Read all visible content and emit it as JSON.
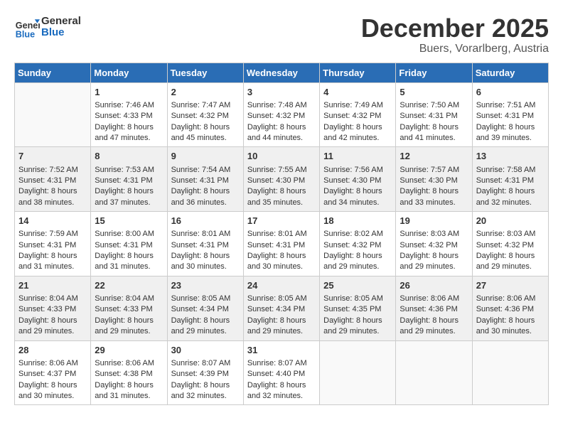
{
  "header": {
    "logo_line1": "General",
    "logo_line2": "Blue",
    "title": "December 2025",
    "subtitle": "Buers, Vorarlberg, Austria"
  },
  "weekdays": [
    "Sunday",
    "Monday",
    "Tuesday",
    "Wednesday",
    "Thursday",
    "Friday",
    "Saturday"
  ],
  "weeks": [
    [
      {
        "day": null,
        "sunrise": null,
        "sunset": null,
        "daylight": null
      },
      {
        "day": "1",
        "sunrise": "Sunrise: 7:46 AM",
        "sunset": "Sunset: 4:33 PM",
        "daylight": "Daylight: 8 hours and 47 minutes."
      },
      {
        "day": "2",
        "sunrise": "Sunrise: 7:47 AM",
        "sunset": "Sunset: 4:32 PM",
        "daylight": "Daylight: 8 hours and 45 minutes."
      },
      {
        "day": "3",
        "sunrise": "Sunrise: 7:48 AM",
        "sunset": "Sunset: 4:32 PM",
        "daylight": "Daylight: 8 hours and 44 minutes."
      },
      {
        "day": "4",
        "sunrise": "Sunrise: 7:49 AM",
        "sunset": "Sunset: 4:32 PM",
        "daylight": "Daylight: 8 hours and 42 minutes."
      },
      {
        "day": "5",
        "sunrise": "Sunrise: 7:50 AM",
        "sunset": "Sunset: 4:31 PM",
        "daylight": "Daylight: 8 hours and 41 minutes."
      },
      {
        "day": "6",
        "sunrise": "Sunrise: 7:51 AM",
        "sunset": "Sunset: 4:31 PM",
        "daylight": "Daylight: 8 hours and 39 minutes."
      }
    ],
    [
      {
        "day": "7",
        "sunrise": "Sunrise: 7:52 AM",
        "sunset": "Sunset: 4:31 PM",
        "daylight": "Daylight: 8 hours and 38 minutes."
      },
      {
        "day": "8",
        "sunrise": "Sunrise: 7:53 AM",
        "sunset": "Sunset: 4:31 PM",
        "daylight": "Daylight: 8 hours and 37 minutes."
      },
      {
        "day": "9",
        "sunrise": "Sunrise: 7:54 AM",
        "sunset": "Sunset: 4:31 PM",
        "daylight": "Daylight: 8 hours and 36 minutes."
      },
      {
        "day": "10",
        "sunrise": "Sunrise: 7:55 AM",
        "sunset": "Sunset: 4:30 PM",
        "daylight": "Daylight: 8 hours and 35 minutes."
      },
      {
        "day": "11",
        "sunrise": "Sunrise: 7:56 AM",
        "sunset": "Sunset: 4:30 PM",
        "daylight": "Daylight: 8 hours and 34 minutes."
      },
      {
        "day": "12",
        "sunrise": "Sunrise: 7:57 AM",
        "sunset": "Sunset: 4:30 PM",
        "daylight": "Daylight: 8 hours and 33 minutes."
      },
      {
        "day": "13",
        "sunrise": "Sunrise: 7:58 AM",
        "sunset": "Sunset: 4:31 PM",
        "daylight": "Daylight: 8 hours and 32 minutes."
      }
    ],
    [
      {
        "day": "14",
        "sunrise": "Sunrise: 7:59 AM",
        "sunset": "Sunset: 4:31 PM",
        "daylight": "Daylight: 8 hours and 31 minutes."
      },
      {
        "day": "15",
        "sunrise": "Sunrise: 8:00 AM",
        "sunset": "Sunset: 4:31 PM",
        "daylight": "Daylight: 8 hours and 31 minutes."
      },
      {
        "day": "16",
        "sunrise": "Sunrise: 8:01 AM",
        "sunset": "Sunset: 4:31 PM",
        "daylight": "Daylight: 8 hours and 30 minutes."
      },
      {
        "day": "17",
        "sunrise": "Sunrise: 8:01 AM",
        "sunset": "Sunset: 4:31 PM",
        "daylight": "Daylight: 8 hours and 30 minutes."
      },
      {
        "day": "18",
        "sunrise": "Sunrise: 8:02 AM",
        "sunset": "Sunset: 4:32 PM",
        "daylight": "Daylight: 8 hours and 29 minutes."
      },
      {
        "day": "19",
        "sunrise": "Sunrise: 8:03 AM",
        "sunset": "Sunset: 4:32 PM",
        "daylight": "Daylight: 8 hours and 29 minutes."
      },
      {
        "day": "20",
        "sunrise": "Sunrise: 8:03 AM",
        "sunset": "Sunset: 4:32 PM",
        "daylight": "Daylight: 8 hours and 29 minutes."
      }
    ],
    [
      {
        "day": "21",
        "sunrise": "Sunrise: 8:04 AM",
        "sunset": "Sunset: 4:33 PM",
        "daylight": "Daylight: 8 hours and 29 minutes."
      },
      {
        "day": "22",
        "sunrise": "Sunrise: 8:04 AM",
        "sunset": "Sunset: 4:33 PM",
        "daylight": "Daylight: 8 hours and 29 minutes."
      },
      {
        "day": "23",
        "sunrise": "Sunrise: 8:05 AM",
        "sunset": "Sunset: 4:34 PM",
        "daylight": "Daylight: 8 hours and 29 minutes."
      },
      {
        "day": "24",
        "sunrise": "Sunrise: 8:05 AM",
        "sunset": "Sunset: 4:34 PM",
        "daylight": "Daylight: 8 hours and 29 minutes."
      },
      {
        "day": "25",
        "sunrise": "Sunrise: 8:05 AM",
        "sunset": "Sunset: 4:35 PM",
        "daylight": "Daylight: 8 hours and 29 minutes."
      },
      {
        "day": "26",
        "sunrise": "Sunrise: 8:06 AM",
        "sunset": "Sunset: 4:36 PM",
        "daylight": "Daylight: 8 hours and 29 minutes."
      },
      {
        "day": "27",
        "sunrise": "Sunrise: 8:06 AM",
        "sunset": "Sunset: 4:36 PM",
        "daylight": "Daylight: 8 hours and 30 minutes."
      }
    ],
    [
      {
        "day": "28",
        "sunrise": "Sunrise: 8:06 AM",
        "sunset": "Sunset: 4:37 PM",
        "daylight": "Daylight: 8 hours and 30 minutes."
      },
      {
        "day": "29",
        "sunrise": "Sunrise: 8:06 AM",
        "sunset": "Sunset: 4:38 PM",
        "daylight": "Daylight: 8 hours and 31 minutes."
      },
      {
        "day": "30",
        "sunrise": "Sunrise: 8:07 AM",
        "sunset": "Sunset: 4:39 PM",
        "daylight": "Daylight: 8 hours and 32 minutes."
      },
      {
        "day": "31",
        "sunrise": "Sunrise: 8:07 AM",
        "sunset": "Sunset: 4:40 PM",
        "daylight": "Daylight: 8 hours and 32 minutes."
      },
      {
        "day": null,
        "sunrise": null,
        "sunset": null,
        "daylight": null
      },
      {
        "day": null,
        "sunrise": null,
        "sunset": null,
        "daylight": null
      },
      {
        "day": null,
        "sunrise": null,
        "sunset": null,
        "daylight": null
      }
    ]
  ]
}
